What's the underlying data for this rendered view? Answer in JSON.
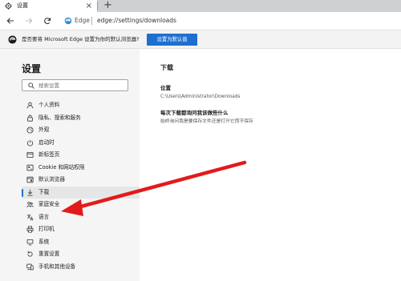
{
  "tab": {
    "title": "设置",
    "close_glyph": "×",
    "new_tab_glyph": "+"
  },
  "toolbar": {
    "brand": "Edge",
    "url": "edge://settings/downloads"
  },
  "infobar": {
    "message": "是否要将 Microsoft Edge 设置为你的默认浏览器?",
    "button": "设置为默认值"
  },
  "sidebar": {
    "title": "设置",
    "search_placeholder": "搜索设置",
    "items": [
      {
        "label": "个人资料",
        "icon": "profile-icon"
      },
      {
        "label": "隐私、搜索和服务",
        "icon": "lock-icon"
      },
      {
        "label": "外观",
        "icon": "appearance-icon"
      },
      {
        "label": "启动时",
        "icon": "power-icon"
      },
      {
        "label": "新标签页",
        "icon": "new-tab-icon"
      },
      {
        "label": "Cookie 和网站权限",
        "icon": "site-permissions-icon"
      },
      {
        "label": "默认浏览器",
        "icon": "default-browser-icon"
      },
      {
        "label": "下载",
        "icon": "download-icon",
        "active": true
      },
      {
        "label": "家庭安全",
        "icon": "family-icon"
      },
      {
        "label": "语言",
        "icon": "language-icon"
      },
      {
        "label": "打印机",
        "icon": "printer-icon"
      },
      {
        "label": "系统",
        "icon": "system-icon"
      },
      {
        "label": "重置设置",
        "icon": "reset-icon"
      },
      {
        "label": "手机和其他设备",
        "icon": "phone-icon"
      }
    ]
  },
  "main": {
    "title": "下载",
    "location_label": "位置",
    "location_value": "C:\\Users\\Administrator\\Downloads",
    "ask_label": "每次下载都询问我该做些什么",
    "ask_desc": "始终询问我是要保存文件还是打开它而不保存"
  },
  "colors": {
    "accent": "#1f6fd0",
    "arrow": "#e21b1b",
    "sidebar_bg": "#f5f5f5",
    "tabstrip_bg": "#cfd0d2"
  }
}
